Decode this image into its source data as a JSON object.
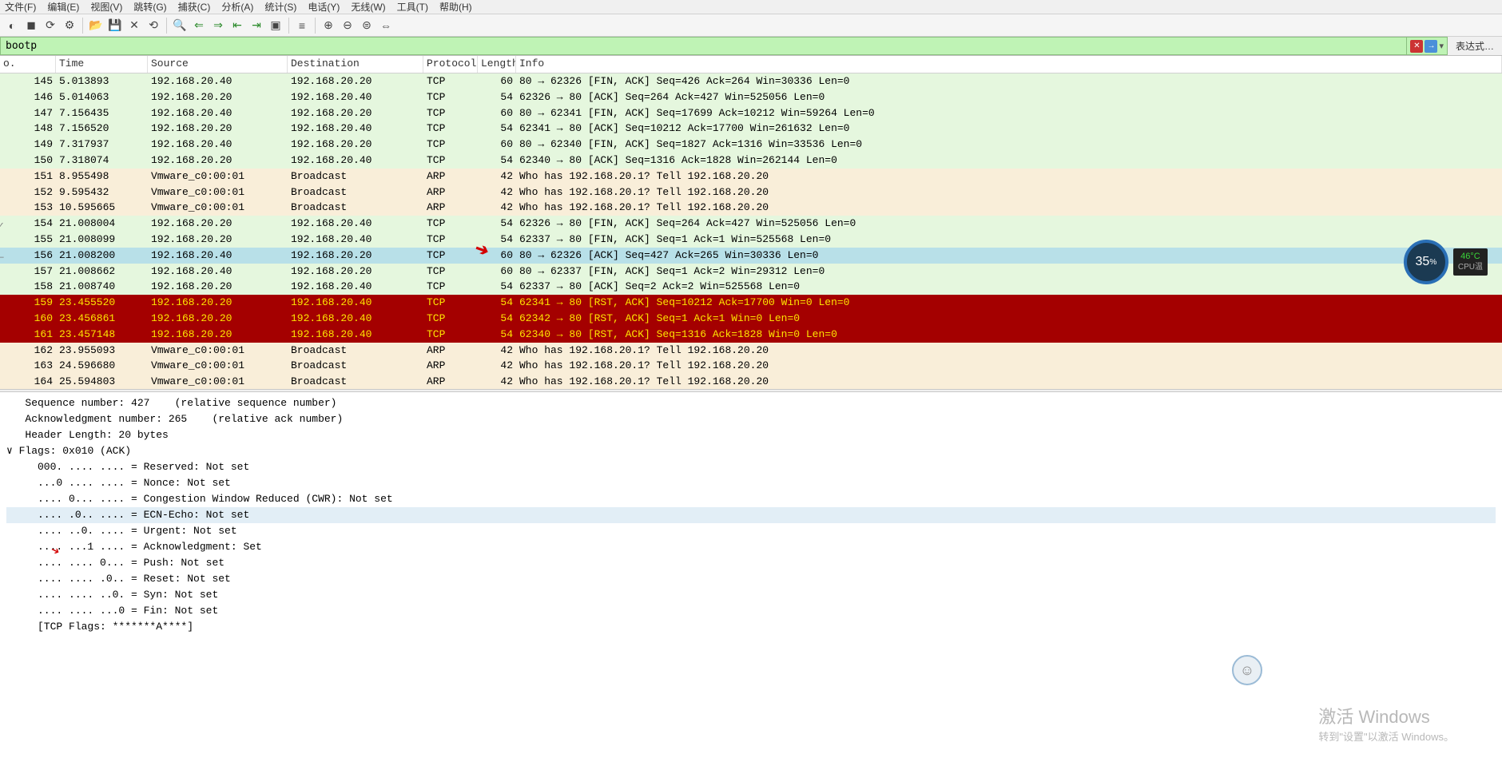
{
  "menu": [
    "文件(F)",
    "编辑(E)",
    "视图(V)",
    "跳转(G)",
    "捕获(C)",
    "分析(A)",
    "统计(S)",
    "电话(Y)",
    "无线(W)",
    "工具(T)",
    "帮助(H)"
  ],
  "filter": {
    "value": "bootp",
    "expr_label": "表达式…"
  },
  "columns": {
    "no": "o.",
    "time": "Time",
    "src": "Source",
    "dst": "Destination",
    "proto": "Protocol",
    "len": "Length",
    "info": "Info"
  },
  "rows": [
    {
      "no": "145",
      "time": "5.013893",
      "src": "192.168.20.40",
      "dst": "192.168.20.20",
      "proto": "TCP",
      "len": "60",
      "info": "80 → 62326 [FIN, ACK] Seq=426 Ack=264 Win=30336 Len=0",
      "cls": "bg-tcp"
    },
    {
      "no": "146",
      "time": "5.014063",
      "src": "192.168.20.20",
      "dst": "192.168.20.40",
      "proto": "TCP",
      "len": "54",
      "info": "62326 → 80 [ACK] Seq=264 Ack=427 Win=525056 Len=0",
      "cls": "bg-tcp"
    },
    {
      "no": "147",
      "time": "7.156435",
      "src": "192.168.20.40",
      "dst": "192.168.20.20",
      "proto": "TCP",
      "len": "60",
      "info": "80 → 62341 [FIN, ACK] Seq=17699 Ack=10212 Win=59264 Len=0",
      "cls": "bg-tcp"
    },
    {
      "no": "148",
      "time": "7.156520",
      "src": "192.168.20.20",
      "dst": "192.168.20.40",
      "proto": "TCP",
      "len": "54",
      "info": "62341 → 80 [ACK] Seq=10212 Ack=17700 Win=261632 Len=0",
      "cls": "bg-tcp"
    },
    {
      "no": "149",
      "time": "7.317937",
      "src": "192.168.20.40",
      "dst": "192.168.20.20",
      "proto": "TCP",
      "len": "60",
      "info": "80 → 62340 [FIN, ACK] Seq=1827 Ack=1316 Win=33536 Len=0",
      "cls": "bg-tcp"
    },
    {
      "no": "150",
      "time": "7.318074",
      "src": "192.168.20.20",
      "dst": "192.168.20.40",
      "proto": "TCP",
      "len": "54",
      "info": "62340 → 80 [ACK] Seq=1316 Ack=1828 Win=262144 Len=0",
      "cls": "bg-tcp"
    },
    {
      "no": "151",
      "time": "8.955498",
      "src": "Vmware_c0:00:01",
      "dst": "Broadcast",
      "proto": "ARP",
      "len": "42",
      "info": "Who has 192.168.20.1? Tell 192.168.20.20",
      "cls": "bg-arp"
    },
    {
      "no": "152",
      "time": "9.595432",
      "src": "Vmware_c0:00:01",
      "dst": "Broadcast",
      "proto": "ARP",
      "len": "42",
      "info": "Who has 192.168.20.1? Tell 192.168.20.20",
      "cls": "bg-arp"
    },
    {
      "no": "153",
      "time": "10.595665",
      "src": "Vmware_c0:00:01",
      "dst": "Broadcast",
      "proto": "ARP",
      "len": "42",
      "info": "Who has 192.168.20.1? Tell 192.168.20.20",
      "cls": "bg-arp"
    },
    {
      "no": "154",
      "time": "21.008004",
      "src": "192.168.20.20",
      "dst": "192.168.20.40",
      "proto": "TCP",
      "len": "54",
      "info": "62326 → 80 [FIN, ACK] Seq=264 Ack=427 Win=525056 Len=0",
      "cls": "bg-tcp",
      "mark": "✓"
    },
    {
      "no": "155",
      "time": "21.008099",
      "src": "192.168.20.20",
      "dst": "192.168.20.40",
      "proto": "TCP",
      "len": "54",
      "info": "62337 → 80 [FIN, ACK] Seq=1 Ack=1 Win=525568 Len=0",
      "cls": "bg-tcp"
    },
    {
      "no": "156",
      "time": "21.008200",
      "src": "192.168.20.40",
      "dst": "192.168.20.20",
      "proto": "TCP",
      "len": "60",
      "info": "80 → 62326 [ACK] Seq=427 Ack=265 Win=30336 Len=0",
      "cls": "bg-sel",
      "mark": "—"
    },
    {
      "no": "157",
      "time": "21.008662",
      "src": "192.168.20.40",
      "dst": "192.168.20.20",
      "proto": "TCP",
      "len": "60",
      "info": "80 → 62337 [FIN, ACK] Seq=1 Ack=2 Win=29312 Len=0",
      "cls": "bg-tcp"
    },
    {
      "no": "158",
      "time": "21.008740",
      "src": "192.168.20.20",
      "dst": "192.168.20.40",
      "proto": "TCP",
      "len": "54",
      "info": "62337 → 80 [ACK] Seq=2 Ack=2 Win=525568 Len=0",
      "cls": "bg-tcp"
    },
    {
      "no": "159",
      "time": "23.455520",
      "src": "192.168.20.20",
      "dst": "192.168.20.40",
      "proto": "TCP",
      "len": "54",
      "info": "62341 → 80 [RST, ACK] Seq=10212 Ack=17700 Win=0 Len=0",
      "cls": "bg-rst"
    },
    {
      "no": "160",
      "time": "23.456861",
      "src": "192.168.20.20",
      "dst": "192.168.20.40",
      "proto": "TCP",
      "len": "54",
      "info": "62342 → 80 [RST, ACK] Seq=1 Ack=1 Win=0 Len=0",
      "cls": "bg-rst"
    },
    {
      "no": "161",
      "time": "23.457148",
      "src": "192.168.20.20",
      "dst": "192.168.20.40",
      "proto": "TCP",
      "len": "54",
      "info": "62340 → 80 [RST, ACK] Seq=1316 Ack=1828 Win=0 Len=0",
      "cls": "bg-rst"
    },
    {
      "no": "162",
      "time": "23.955093",
      "src": "Vmware_c0:00:01",
      "dst": "Broadcast",
      "proto": "ARP",
      "len": "42",
      "info": "Who has 192.168.20.1? Tell 192.168.20.20",
      "cls": "bg-arp"
    },
    {
      "no": "163",
      "time": "24.596680",
      "src": "Vmware_c0:00:01",
      "dst": "Broadcast",
      "proto": "ARP",
      "len": "42",
      "info": "Who has 192.168.20.1? Tell 192.168.20.20",
      "cls": "bg-arp"
    },
    {
      "no": "164",
      "time": "25.594803",
      "src": "Vmware_c0:00:01",
      "dst": "Broadcast",
      "proto": "ARP",
      "len": "42",
      "info": "Who has 192.168.20.1? Tell 192.168.20.20",
      "cls": "bg-arp"
    }
  ],
  "details": [
    {
      "t": "   Sequence number: 427    (relative sequence number)",
      "sel": false
    },
    {
      "t": "   Acknowledgment number: 265    (relative ack number)",
      "sel": false
    },
    {
      "t": "   Header Length: 20 bytes",
      "sel": false
    },
    {
      "t": "∨ Flags: 0x010 (ACK)",
      "sel": false,
      "exp": true
    },
    {
      "t": "     000. .... .... = Reserved: Not set",
      "sel": false
    },
    {
      "t": "     ...0 .... .... = Nonce: Not set",
      "sel": false
    },
    {
      "t": "     .... 0... .... = Congestion Window Reduced (CWR): Not set",
      "sel": false
    },
    {
      "t": "     .... .0.. .... = ECN-Echo: Not set",
      "sel": true
    },
    {
      "t": "     .... ..0. .... = Urgent: Not set",
      "sel": false
    },
    {
      "t": "     .... ...1 .... = Acknowledgment: Set",
      "sel": false,
      "arrow": true
    },
    {
      "t": "     .... .... 0... = Push: Not set",
      "sel": false
    },
    {
      "t": "     .... .... .0.. = Reset: Not set",
      "sel": false
    },
    {
      "t": "     .... .... ..0. = Syn: Not set",
      "sel": false
    },
    {
      "t": "     .... .... ...0 = Fin: Not set",
      "sel": false
    },
    {
      "t": "     [TCP Flags: *******A****]",
      "sel": false
    }
  ],
  "watermark": {
    "line1": "激活 Windows",
    "line2": "转到\"设置\"以激活 Windows。"
  },
  "widget": {
    "pct": "35",
    "pct_unit": "%",
    "temp": "46°C",
    "temp_label": "CPU温"
  }
}
